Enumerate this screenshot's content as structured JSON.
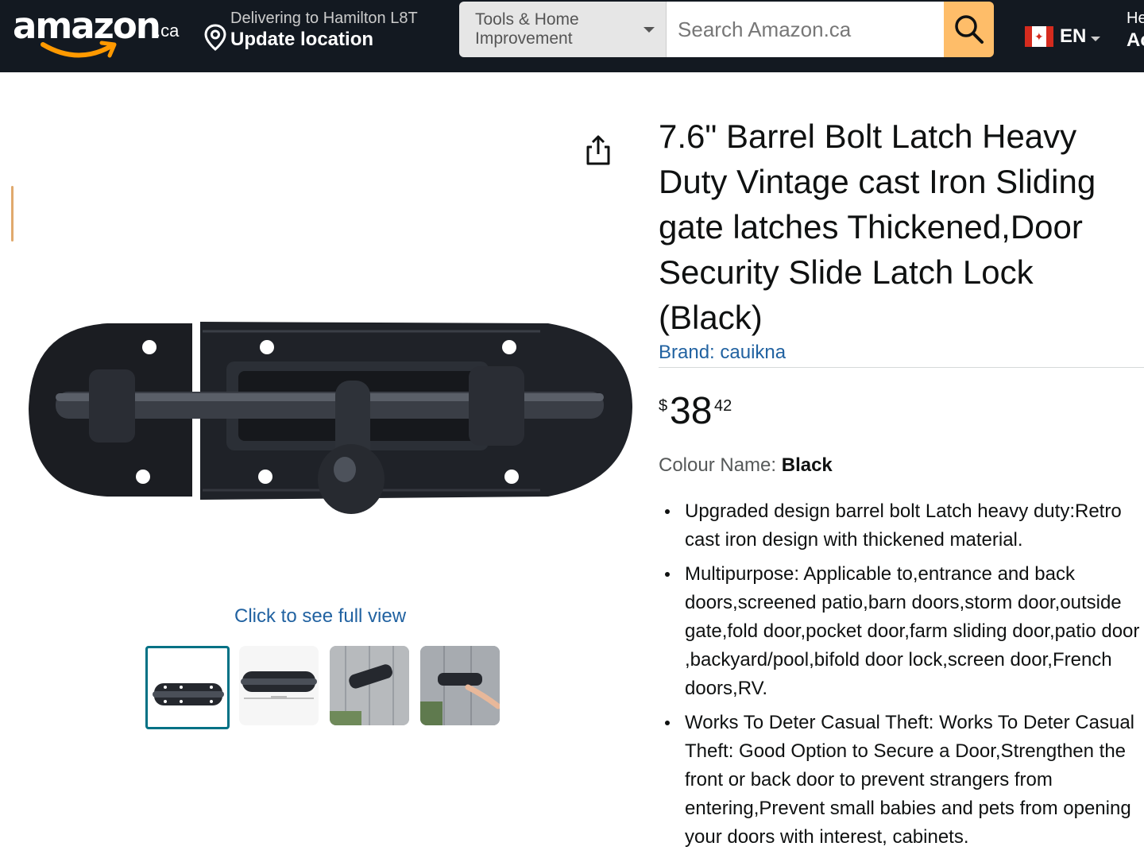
{
  "header": {
    "logo_text": "amazon",
    "logo_tld": ".ca",
    "deliver_line1": "Delivering to Hamilton L8T",
    "deliver_line2": "Update location",
    "search_category": "Tools & Home Improvement",
    "search_placeholder": "Search Amazon.ca",
    "language": "EN",
    "account_line1": "He",
    "account_line2": "Ac"
  },
  "gallery": {
    "full_view_link": "Click to see full view",
    "thumbnail_count": 4,
    "selected_thumbnail": 1
  },
  "product": {
    "title": "7.6\" Barrel Bolt Latch Heavy Duty Vintage cast Iron Sliding gate latches Thickened,Door Security Slide Latch Lock (Black)",
    "brand": "Brand: cauikna",
    "price": {
      "symbol": "$",
      "whole": "38",
      "fraction": "42"
    },
    "colour_label": "Colour Name:",
    "colour_value": "Black",
    "bullets": [
      "Upgraded design barrel bolt Latch heavy duty:Retro cast iron design with thickened material.",
      "Multipurpose: Applicable to,entrance and back doors,screened patio,barn doors,storm door,outside gate,fold door,pocket door,farm sliding door,patio door ,backyard/pool,bifold door lock,screen door,French doors,RV.",
      "Works To Deter Casual Theft: Works To Deter Casual Theft: Good Option to Secure a Door,Strengthen the front or back door to prevent strangers from entering,Prevent small babies and pets from opening your doors with interest, cabinets."
    ]
  },
  "colors": {
    "header_bg": "#131921",
    "search_button": "#febd69",
    "link": "#2162a1",
    "thumb_selected_border": "#007185"
  }
}
